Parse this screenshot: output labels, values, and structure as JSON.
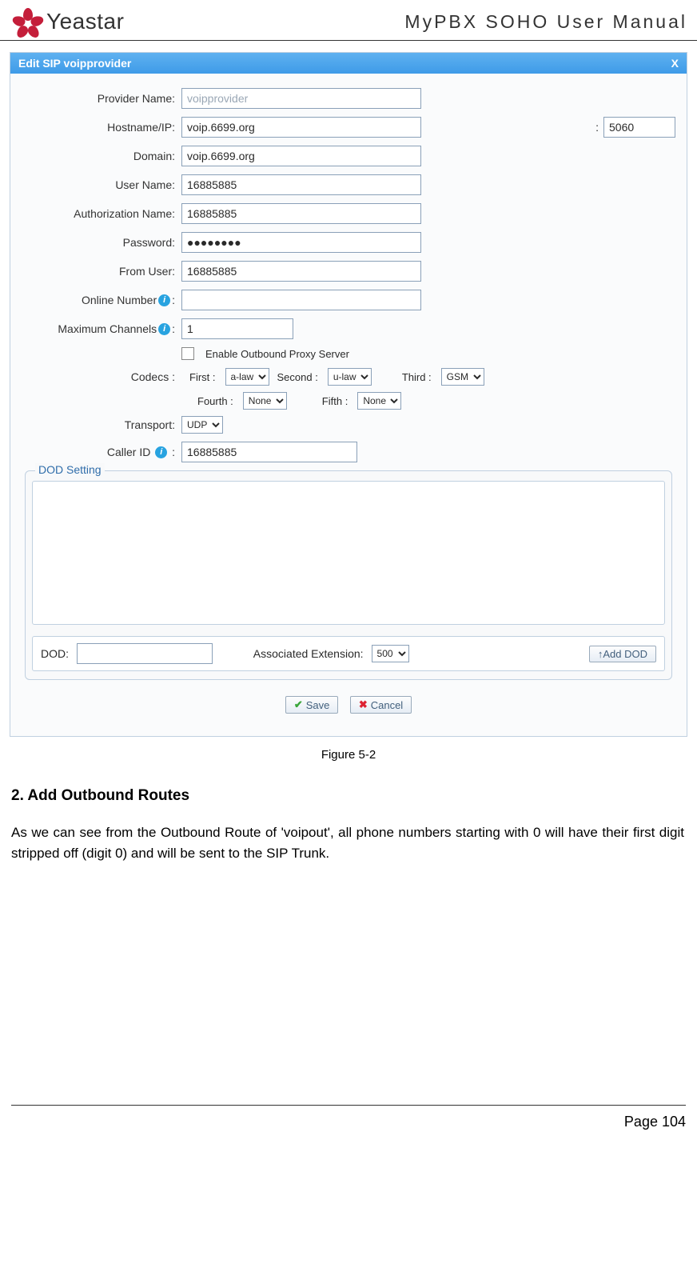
{
  "header": {
    "brand": "Yeastar",
    "doc_title": "MyPBX SOHO User Manual"
  },
  "dialog": {
    "title": "Edit SIP voipprovider",
    "close": "X",
    "fields": {
      "provider_name_label": "Provider Name:",
      "provider_name_value": "voipprovider",
      "hostname_label": "Hostname/IP:",
      "hostname_value": "voip.6699.org",
      "port_value": "5060",
      "domain_label": "Domain:",
      "domain_value": "voip.6699.org",
      "username_label": "User Name:",
      "username_value": "16885885",
      "authname_label": "Authorization Name:",
      "authname_value": "16885885",
      "password_label": "Password:",
      "password_value": "●●●●●●●●",
      "fromuser_label": "From User:",
      "fromuser_value": "16885885",
      "online_label_pre": "Online Number",
      "online_label_post": ":",
      "online_value": "",
      "maxch_label_pre": "Maximum Channels",
      "maxch_label_post": ":",
      "maxch_value": "1",
      "enable_proxy_label": "Enable Outbound Proxy Server",
      "codecs_label": "Codecs :",
      "first_label": "First :",
      "first_value": "a-law",
      "second_label": "Second :",
      "second_value": "u-law",
      "third_label": "Third :",
      "third_value": "GSM",
      "fourth_label": "Fourth :",
      "fourth_value": "None",
      "fifth_label": "Fifth :",
      "fifth_value": "None",
      "transport_label": "Transport:",
      "transport_value": "UDP",
      "callerid_label_pre": "Caller ID",
      "callerid_label_post": ":",
      "callerid_value": "16885885"
    },
    "dod": {
      "legend": "DOD Setting",
      "dod_label": "DOD:",
      "dod_value": "",
      "assoc_label": "Associated Extension:",
      "assoc_value": "500",
      "add_btn": "↑Add DOD"
    },
    "buttons": {
      "save": "Save",
      "cancel": "Cancel"
    }
  },
  "caption": "Figure 5-2",
  "section": {
    "heading": "2. Add Outbound Routes",
    "body": "As we can see from the Outbound Route of 'voipout', all phone numbers starting with 0 will have their first digit stripped off (digit 0) and will be sent to the SIP Trunk."
  },
  "footer": {
    "page": "Page 104"
  }
}
